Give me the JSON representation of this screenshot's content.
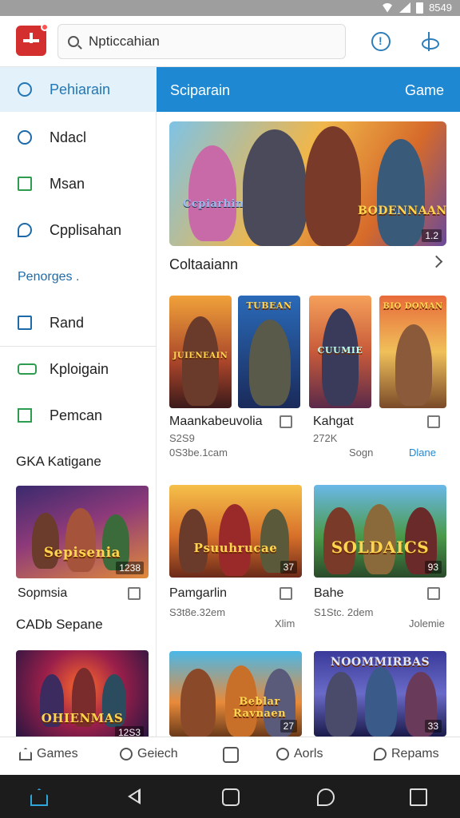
{
  "status": {
    "time": "8549"
  },
  "search": {
    "value": "Npticcahian"
  },
  "sidebar": {
    "items": [
      {
        "label": "Pehiarain",
        "icon": "search-icon"
      },
      {
        "label": "Ndacl",
        "icon": "circle-icon"
      },
      {
        "label": "Msan",
        "icon": "bracket-icon"
      },
      {
        "label": "Cpplisahan",
        "icon": "bubble-icon"
      },
      {
        "label": "Rand",
        "icon": "document-icon"
      },
      {
        "label": "Kploigain",
        "icon": "controller-icon"
      },
      {
        "label": "Pemcan",
        "icon": "square-icon"
      }
    ],
    "section_heading": "Penorges .",
    "category_heading": "GKA Katigane",
    "card1_label": "Sopmsia",
    "card1_badge": "1238",
    "section2_heading": "CADb Sepane",
    "card2_badge": "12S3",
    "card1_art_text": "Sepisenia",
    "card2_art_text": "OHIENMAS"
  },
  "main": {
    "header_left": "Sciparain",
    "header_right": "Game",
    "banner": {
      "art_text": "Ccpiarhin",
      "art_text2": "BODENNAAN",
      "badge": "1.2"
    },
    "section_title": "Coltaaiann",
    "tiles_art": [
      "JUIENEAIN",
      "TUBEAN",
      "CUUMIE",
      "BIO DOMAN"
    ],
    "games": [
      {
        "title": "Maankabeuvolia",
        "sub1": "S2S9",
        "sub2": "0S3be.1cam"
      },
      {
        "title": "Kahgat",
        "sub1": "272K",
        "sub2": "Sogn",
        "link": "Dlane"
      }
    ],
    "cards_row1": [
      {
        "title": "Pamgarlin",
        "sub": "S3t8e.32em",
        "sub2": "Xlim",
        "badge": "37",
        "art_text": "Psuuhrucae"
      },
      {
        "title": "Bahe",
        "sub": "S1Stc. 2dem",
        "sub2": "Jolemie",
        "badge": "93",
        "art_text": "SOLDAICS"
      }
    ],
    "cards_row2": [
      {
        "badge": "27",
        "art_text": "Beblar Ravnaen"
      },
      {
        "badge": "33",
        "art_text": "NOOMMIRBAS"
      }
    ]
  },
  "bottomnav": {
    "items": [
      {
        "label": "Games",
        "icon": "home-icon"
      },
      {
        "label": "Geiech",
        "icon": "search-icon"
      },
      {
        "label": "",
        "icon": "box-icon"
      },
      {
        "label": "Aorls",
        "icon": "search-icon"
      },
      {
        "label": "Repams",
        "icon": "bubble-icon"
      }
    ]
  },
  "colors": {
    "accent": "#1e88d3",
    "brand": "#d32f2f",
    "active_bg": "#e3f1fb"
  }
}
